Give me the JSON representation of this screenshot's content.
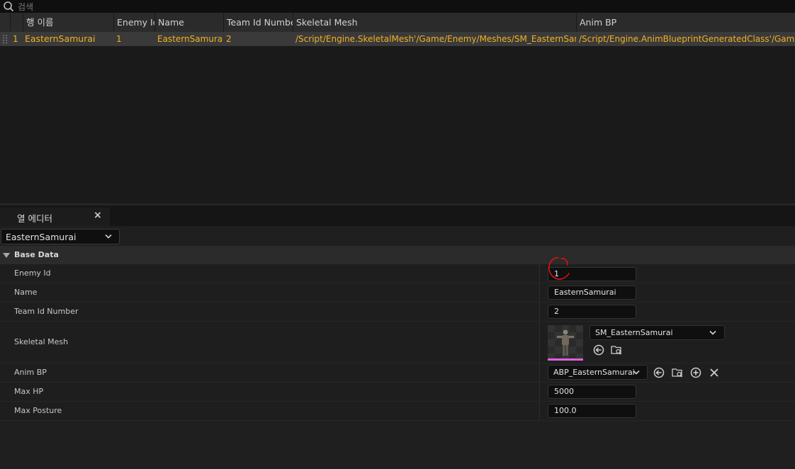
{
  "search": {
    "placeholder": "검색"
  },
  "table": {
    "columns": [
      "행 이름",
      "Enemy Id",
      "Name",
      "Team Id Number",
      "Skeletal Mesh",
      "Anim BP"
    ],
    "rows": [
      {
        "index": "1",
        "row_name": "EasternSamurai",
        "enemy_id": "1",
        "name": "EasternSamurai",
        "team_id": "2",
        "skeletal_mesh": "/Script/Engine.SkeletalMesh'/Game/Enemy/Meshes/SM_EasternSamurai",
        "anim_bp": "/Script/Engine.AnimBlueprintGeneratedClass'/Game/Enemy"
      }
    ]
  },
  "tab": {
    "label": "열 에디터",
    "close": "×"
  },
  "editor": {
    "selected_row": "EasternSamurai",
    "category": "Base Data",
    "props": {
      "enemy_id": {
        "label": "Enemy Id",
        "value": "1"
      },
      "name": {
        "label": "Name",
        "value": "EasternSamurai"
      },
      "team_id": {
        "label": "Team Id Number",
        "value": "2"
      },
      "skeletal_mesh": {
        "label": "Skeletal Mesh",
        "value": "SM_EasternSamurai"
      },
      "anim_bp": {
        "label": "Anim BP",
        "value": "ABP_EasternSamurai"
      },
      "max_hp": {
        "label": "Max HP",
        "value": "5000"
      },
      "max_posture": {
        "label": "Max Posture",
        "value": "100.0"
      }
    }
  },
  "colors": {
    "row_text": "#f3b121",
    "annotation": "#e01010",
    "thumbnail_accent": "#e060e0"
  },
  "icons": [
    "search-icon",
    "chevron-down-icon",
    "collapse-triangle-icon",
    "use-selected-icon",
    "browse-icon",
    "add-icon",
    "clear-icon",
    "drag-grip-icon"
  ]
}
